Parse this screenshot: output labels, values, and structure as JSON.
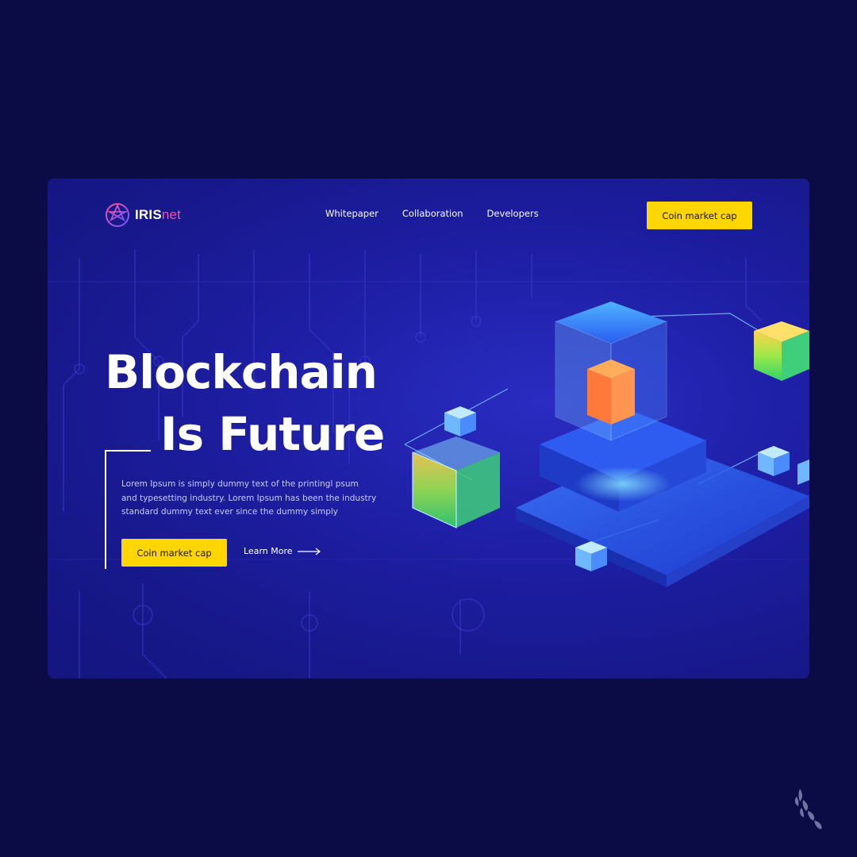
{
  "brand": {
    "name_main": "IRIS",
    "name_accent": "net"
  },
  "nav": {
    "items": [
      {
        "label": "Whitepaper"
      },
      {
        "label": "Collaboration"
      },
      {
        "label": "Developers"
      }
    ],
    "cta_label": "Coin market cap"
  },
  "hero": {
    "title_line1": "Blockchain",
    "title_line2": "Is Future",
    "description_line1": "Lorem Ipsum is simply dummy text of the printingl psum",
    "description_line2": "and typesetting industry. Lorem Ipsum has been the industry",
    "description_line3": "standard dummy text ever since the  dummy simply",
    "cta_label": "Coin market cap",
    "secondary_label": "Learn More"
  },
  "colors": {
    "page_bg": "#0b0b45",
    "hero_bg": "#1d1ea3",
    "accent_yellow": "#ffd600",
    "brand_pink": "#ff4f9a"
  },
  "icons": {
    "logo": "iris-logo-icon",
    "arrow": "arrow-right-icon",
    "corner": "laurel-icon"
  }
}
